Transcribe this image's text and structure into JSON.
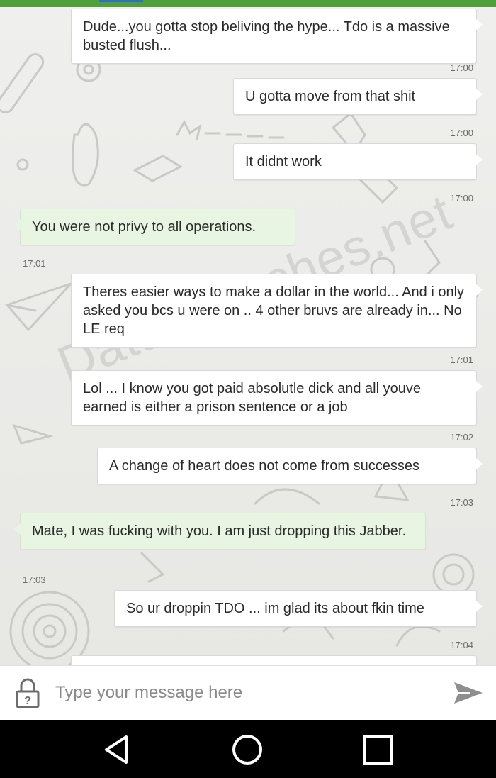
{
  "composer": {
    "placeholder": "Type your message here"
  },
  "watermark": "DataBreaches.net",
  "messages": [
    {
      "dir": "out",
      "text": "Dude...you gotta stop beliving the hype... Tdo is a massive busted flush...",
      "time": "17:00"
    },
    {
      "dir": "out",
      "text": "U gotta move from that shit",
      "time": "17:00"
    },
    {
      "dir": "out",
      "text": "It didnt work",
      "time": "17:00"
    },
    {
      "dir": "in",
      "text": "You were not privy to all operations.",
      "time": "17:01"
    },
    {
      "dir": "out",
      "text": "Theres easier ways to make a dollar in the world... And i only asked you bcs u were on .. 4 other bruvs are already in... No LE req",
      "time": "17:01"
    },
    {
      "dir": "out",
      "text": "Lol ... I know you got paid absolutle dick and all youve earned is either a prison sentence or a job",
      "time": "17:02"
    },
    {
      "dir": "out",
      "text": "A change of heart does not come from successes",
      "time": "17:03"
    },
    {
      "dir": "in",
      "text": "Mate, I was fucking with you. I am just dropping this Jabber.",
      "time": "17:03"
    },
    {
      "dir": "out",
      "text": "So ur droppin TDO ... im glad its about fkin time",
      "time": "17:04"
    }
  ],
  "icons": {
    "lock": "lock-question-icon",
    "send": "send-icon",
    "back": "nav-back-icon",
    "home": "nav-home-icon",
    "recents": "nav-recents-icon"
  },
  "colors": {
    "incoming_bubble": "#e8f5e2",
    "outgoing_bubble": "#ffffff",
    "topbar": "#4f9f3a"
  }
}
